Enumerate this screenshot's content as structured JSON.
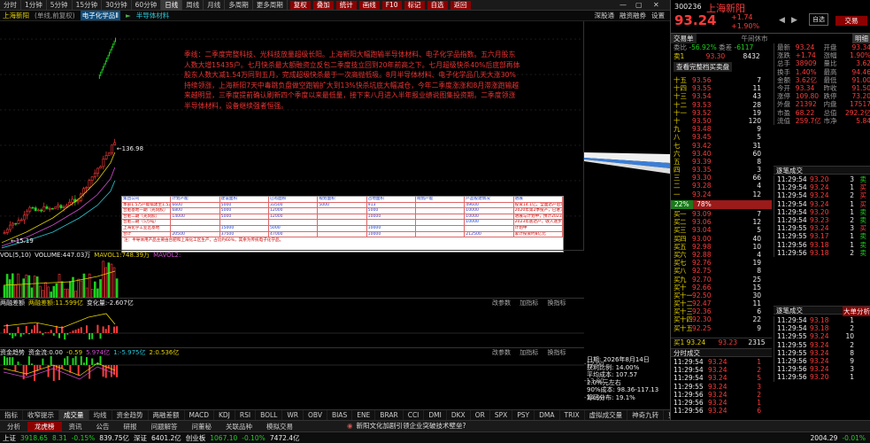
{
  "toolbar": {
    "periods": [
      "分时",
      "1分钟",
      "5分钟",
      "15分钟",
      "30分钟",
      "60分钟",
      "日线",
      "周线",
      "月线",
      "多周期",
      "更多周期"
    ],
    "active_period": "日线",
    "tools": [
      "复权",
      "叠加",
      "统计",
      "画线",
      "F10",
      "标记",
      "自选",
      "返回"
    ],
    "win_controls": [
      "▢",
      "—",
      "✕"
    ]
  },
  "subbar": {
    "name": "上海新阳",
    "price_note": "(单线,前复权)",
    "sector1": "电子化学品Ⅱ",
    "sector2": "半导体材料",
    "right": [
      "深股通",
      "融资融券",
      "设置"
    ]
  },
  "chart": {
    "price_marks": [
      "136.98",
      "15.19"
    ],
    "annotation": "季线：二季度完整科技、光科技放量超级长阳。上海新阳大幅跑输半导体材料、电子化学品指数。五六月股东人数大增15435户。七月快杀最大额融资立反包二季度技立回到20年前高之下。七月超级快杀40%后底部再体股东人数大减1.54万同到五月，完成超级快杀最于一次高抛低吸。8月半导体材料、电子化学品几天大涨30%持续领涨，上海新阳7天中毒跳负盘做空跑输扩大到13%快杀坑底大幅减仓，今年二季度涨涨和8月滞涨跑输越来越明显，三季度提前确认刷新四个季度以来最低量，接下来八月进入半年报业绩说图集投资期。二季度领涨半导体材料，设备继续强者恒强。",
    "table": {
      "header": [
        "集团公司",
        "计划产能",
        "建设面积",
        "已有面积",
        "规划面积",
        "占地面积",
        "规划产能",
        "产品投建情况",
        "进展"
      ],
      "rows": [
        [
          "本部1.5万产能拟建至1.5万吨",
          "6600",
          "5000",
          "33500",
          "5000",
          "913",
          "",
          "49600",
          "投资14.1亿，全面达产后年收入24亿元。"
        ],
        [
          "合肥基地一期（光刻胶）",
          "6800",
          "5000",
          "12000",
          "",
          "5000",
          "",
          "10000",
          "2020年第2季投产，已进入量产"
        ],
        [
          "合肥二期（光刻胶）",
          "14000",
          "5000",
          "12000",
          "",
          "10000",
          "",
          "10000",
          "进展与计划中，预计2023年底完工"
        ],
        [
          "合肥二期（5万吨）",
          "",
          "",
          "",
          "",
          "",
          "",
          "10000",
          "2023年底达产，收入逐步达到7亿元"
        ],
        [
          "上海化学工业区基地",
          "",
          "15000",
          "5000",
          "",
          "10000",
          "",
          "",
          "计划中"
        ],
        [
          "合计",
          "20500",
          "37500",
          "47000",
          "",
          "10000",
          "",
          "212500",
          "累计投资约8亿元"
        ]
      ],
      "note": "注：半导体用产品主要由合肥和上海化工区生产，占比约60%，其余为传统电子化学品。"
    }
  },
  "volume_panel": {
    "label": "VOL(5,10)",
    "volume": "VOLUME:447.03万",
    "ma5": "MAVOL1:748.39万",
    "ma10": "MAVOL2:"
  },
  "margin_panel": {
    "label": "两融差额",
    "val1": "两融差额:11.599亿",
    "val2": "变化量:-2.607亿",
    "tools": [
      "改参数",
      "加指标",
      "换指标"
    ]
  },
  "fund_panel": {
    "label": "资金趋势",
    "val1": "资金流:0.00",
    "val2": "-0.59",
    "val3": "5.974亿",
    "val4": "1:-5.975亿",
    "val5": "2:0.536亿",
    "tools": [
      "改参数",
      "加指标",
      "换指标"
    ],
    "ticks": [
      "-12.00",
      "-13.00",
      "-14.00"
    ]
  },
  "infobox": {
    "date": "日期: 2026年8月14日",
    "profit": "获利比例: 14.00%",
    "avg_cost": "平均成本: 107.57",
    "cost_range": "2.0%元左右",
    "dist": "集中度: 0.00%",
    "range": "90%成本: 98.36-117.13",
    "score": "筹码分布: 19.1%",
    "low": "日线: 18"
  },
  "indicator_tabs": [
    "指标",
    "收窄提示",
    "成交量",
    "均线",
    "资金趋势",
    "两融差额",
    "MACD",
    "KDJ",
    "RSI",
    "BOLL",
    "WR",
    "OBV",
    "BIAS",
    "ENE",
    "BRAR",
    "CCI",
    "DMI",
    "DKX",
    "OR",
    "SPX",
    "PSY",
    "DMA",
    "TRIX",
    "虚拟成交量",
    "神奇九转",
    "更多"
  ],
  "active_indicator": "成交量",
  "bottom_tabs": [
    "分析",
    "龙虎榜",
    "资讯",
    "公告",
    "研报",
    "问题解答",
    "问董秘",
    "关联品种",
    "模拟交易"
  ],
  "news": "新阳文化加剧引领企业突破技术壁垒?",
  "status": {
    "sh": "上证",
    "sh_val": "3918.65",
    "sh_chg": "8.31",
    "sh_pct": "-0.15%",
    "sh_amt": "839.75亿",
    "sz": "深证",
    "sz_val": "6401.2亿",
    "cy": "创业板",
    "cy_val": "1067.10",
    "cy_pct": "-0.10%",
    "cy_amt": "7472.4亿",
    "time": "2004.29",
    "pct2": "-0.01%"
  },
  "right": {
    "code": "300236",
    "name": "上海新阳",
    "price": "93.24",
    "chg": "+1.74",
    "pct": "+1.90%",
    "tabs": [
      "交易单",
      "午间休市",
      "明细"
    ],
    "commission_ratio": "-56.92%",
    "commission_diff": "-6117",
    "trade_label": "委比",
    "trade_label2": "委差",
    "ask_rows": [
      [
        "十五",
        "93.56",
        "7",
        "卖二",
        "93.20",
        "45"
      ],
      [
        "十四",
        "93.55",
        "11",
        "卖一",
        "93.30",
        "66"
      ],
      [
        "十三",
        "93.54",
        "43",
        "",
        "",
        ""
      ],
      [
        "十二",
        "93.53",
        "28",
        "",
        "",
        ""
      ],
      [
        "十一",
        "93.52",
        "19",
        "",
        "",
        ""
      ],
      [
        "十",
        "93.50",
        "120",
        "",
        "",
        ""
      ],
      [
        "九",
        "93.48",
        "9",
        "",
        "",
        ""
      ],
      [
        "八",
        "93.45",
        "5",
        "",
        "",
        ""
      ],
      [
        "七",
        "93.42",
        "31",
        "",
        "",
        ""
      ],
      [
        "六",
        "93.40",
        "60",
        "",
        "",
        ""
      ],
      [
        "五",
        "93.39",
        "8",
        "",
        "",
        ""
      ],
      [
        "四",
        "93.35",
        "3",
        "",
        "",
        ""
      ],
      [
        "三",
        "93.30",
        "66",
        "",
        "",
        ""
      ],
      [
        "二",
        "93.28",
        "4",
        "",
        "",
        ""
      ],
      [
        "一",
        "93.24",
        "12",
        "",
        "",
        ""
      ]
    ],
    "bid_rows": [
      [
        "一",
        "93.09",
        "7"
      ],
      [
        "二",
        "93.06",
        "12"
      ],
      [
        "三",
        "93.04",
        "5"
      ],
      [
        "四",
        "93.00",
        "40"
      ],
      [
        "五",
        "92.98",
        "10"
      ],
      [
        "六",
        "92.88",
        "4"
      ],
      [
        "七",
        "92.76",
        "19"
      ],
      [
        "八",
        "92.75",
        "8"
      ],
      [
        "九",
        "92.70",
        "25"
      ],
      [
        "十",
        "92.66",
        "15"
      ],
      [
        "十一",
        "92.50",
        "30"
      ],
      [
        "十二",
        "92.47",
        "11"
      ],
      [
        "十三",
        "92.36",
        "6"
      ],
      [
        "十四",
        "92.30",
        "22"
      ],
      [
        "十五",
        "92.25",
        "9"
      ]
    ],
    "buy_bar": "22%",
    "sell_bar": "78%",
    "best_bid": "买1 93.24",
    "bid_big": "93.23",
    "bid_big2": "2315",
    "sell_best": "卖1",
    "sell_price": "93.30",
    "sell_vol": "8432",
    "quote_rows": [
      [
        "最新",
        "93.24",
        "开盘",
        "93.34"
      ],
      [
        "涨跌",
        "+1.74",
        "涨幅",
        "1.90%"
      ],
      [
        "总手",
        "38909",
        "量比",
        "3.62"
      ],
      [
        "换手",
        "1.40%",
        "最高",
        "94.46"
      ],
      [
        "金额",
        "3.62亿",
        "最低",
        "91.00"
      ],
      [
        "今开",
        "93.34",
        "昨收",
        "91.50"
      ],
      [
        "涨停",
        "109.80",
        "跌停",
        "73.20"
      ],
      [
        "外盘",
        "21392",
        "内盘",
        "17517"
      ],
      [
        "市盈",
        "68.22",
        "总值",
        "292.2亿"
      ],
      [
        "流值",
        "259.7亿",
        "市净",
        "5.84"
      ]
    ],
    "quote_labels": [
      "量比",
      "均价"
    ],
    "trades_title": "逐笔成交",
    "trades_btn": "大单分析",
    "trades": [
      [
        "11:29:54",
        "93.20",
        "3",
        "卖"
      ],
      [
        "11:29:54",
        "93.24",
        "1",
        "买"
      ],
      [
        "11:29:54",
        "93.24",
        "2",
        "买"
      ],
      [
        "11:29:54",
        "93.24",
        "1",
        "买"
      ],
      [
        "11:29:54",
        "93.20",
        "1",
        "卖"
      ],
      [
        "11:29:54",
        "93.23",
        "2",
        "卖"
      ],
      [
        "11:29:55",
        "93.24",
        "3",
        "买"
      ],
      [
        "11:29:55",
        "93.17",
        "1",
        "卖"
      ],
      [
        "11:29:56",
        "93.18",
        "1",
        "卖"
      ],
      [
        "11:29:56",
        "93.18",
        "2",
        "卖"
      ]
    ],
    "trades2": [
      [
        "11:29:54",
        "93.18",
        "1"
      ],
      [
        "11:29:54",
        "93.18",
        "2"
      ],
      [
        "11:29:55",
        "93.24",
        "10"
      ],
      [
        "11:29:55",
        "93.24",
        "2"
      ],
      [
        "11:29:55",
        "93.24",
        "8"
      ],
      [
        "11:29:56",
        "93.24",
        "9"
      ],
      [
        "11:29:56",
        "93.24",
        "3"
      ],
      [
        "11:29:56",
        "93.20",
        "1"
      ]
    ],
    "fenshi_title": "分时成交",
    "fenshi": [
      [
        "11:29:54",
        "93.24",
        "1"
      ],
      [
        "11:29:54",
        "93.24",
        "2"
      ],
      [
        "11:29:54",
        "93.24",
        "5"
      ],
      [
        "11:29:55",
        "93.24",
        "3"
      ],
      [
        "11:29:56",
        "93.24",
        "2"
      ],
      [
        "11:29:56",
        "93.24",
        "1"
      ],
      [
        "11:29:56",
        "93.24",
        "6"
      ]
    ],
    "buy_btn": "交易",
    "add_btn": "自选",
    "small_label": "查看完整档买卖盘"
  }
}
